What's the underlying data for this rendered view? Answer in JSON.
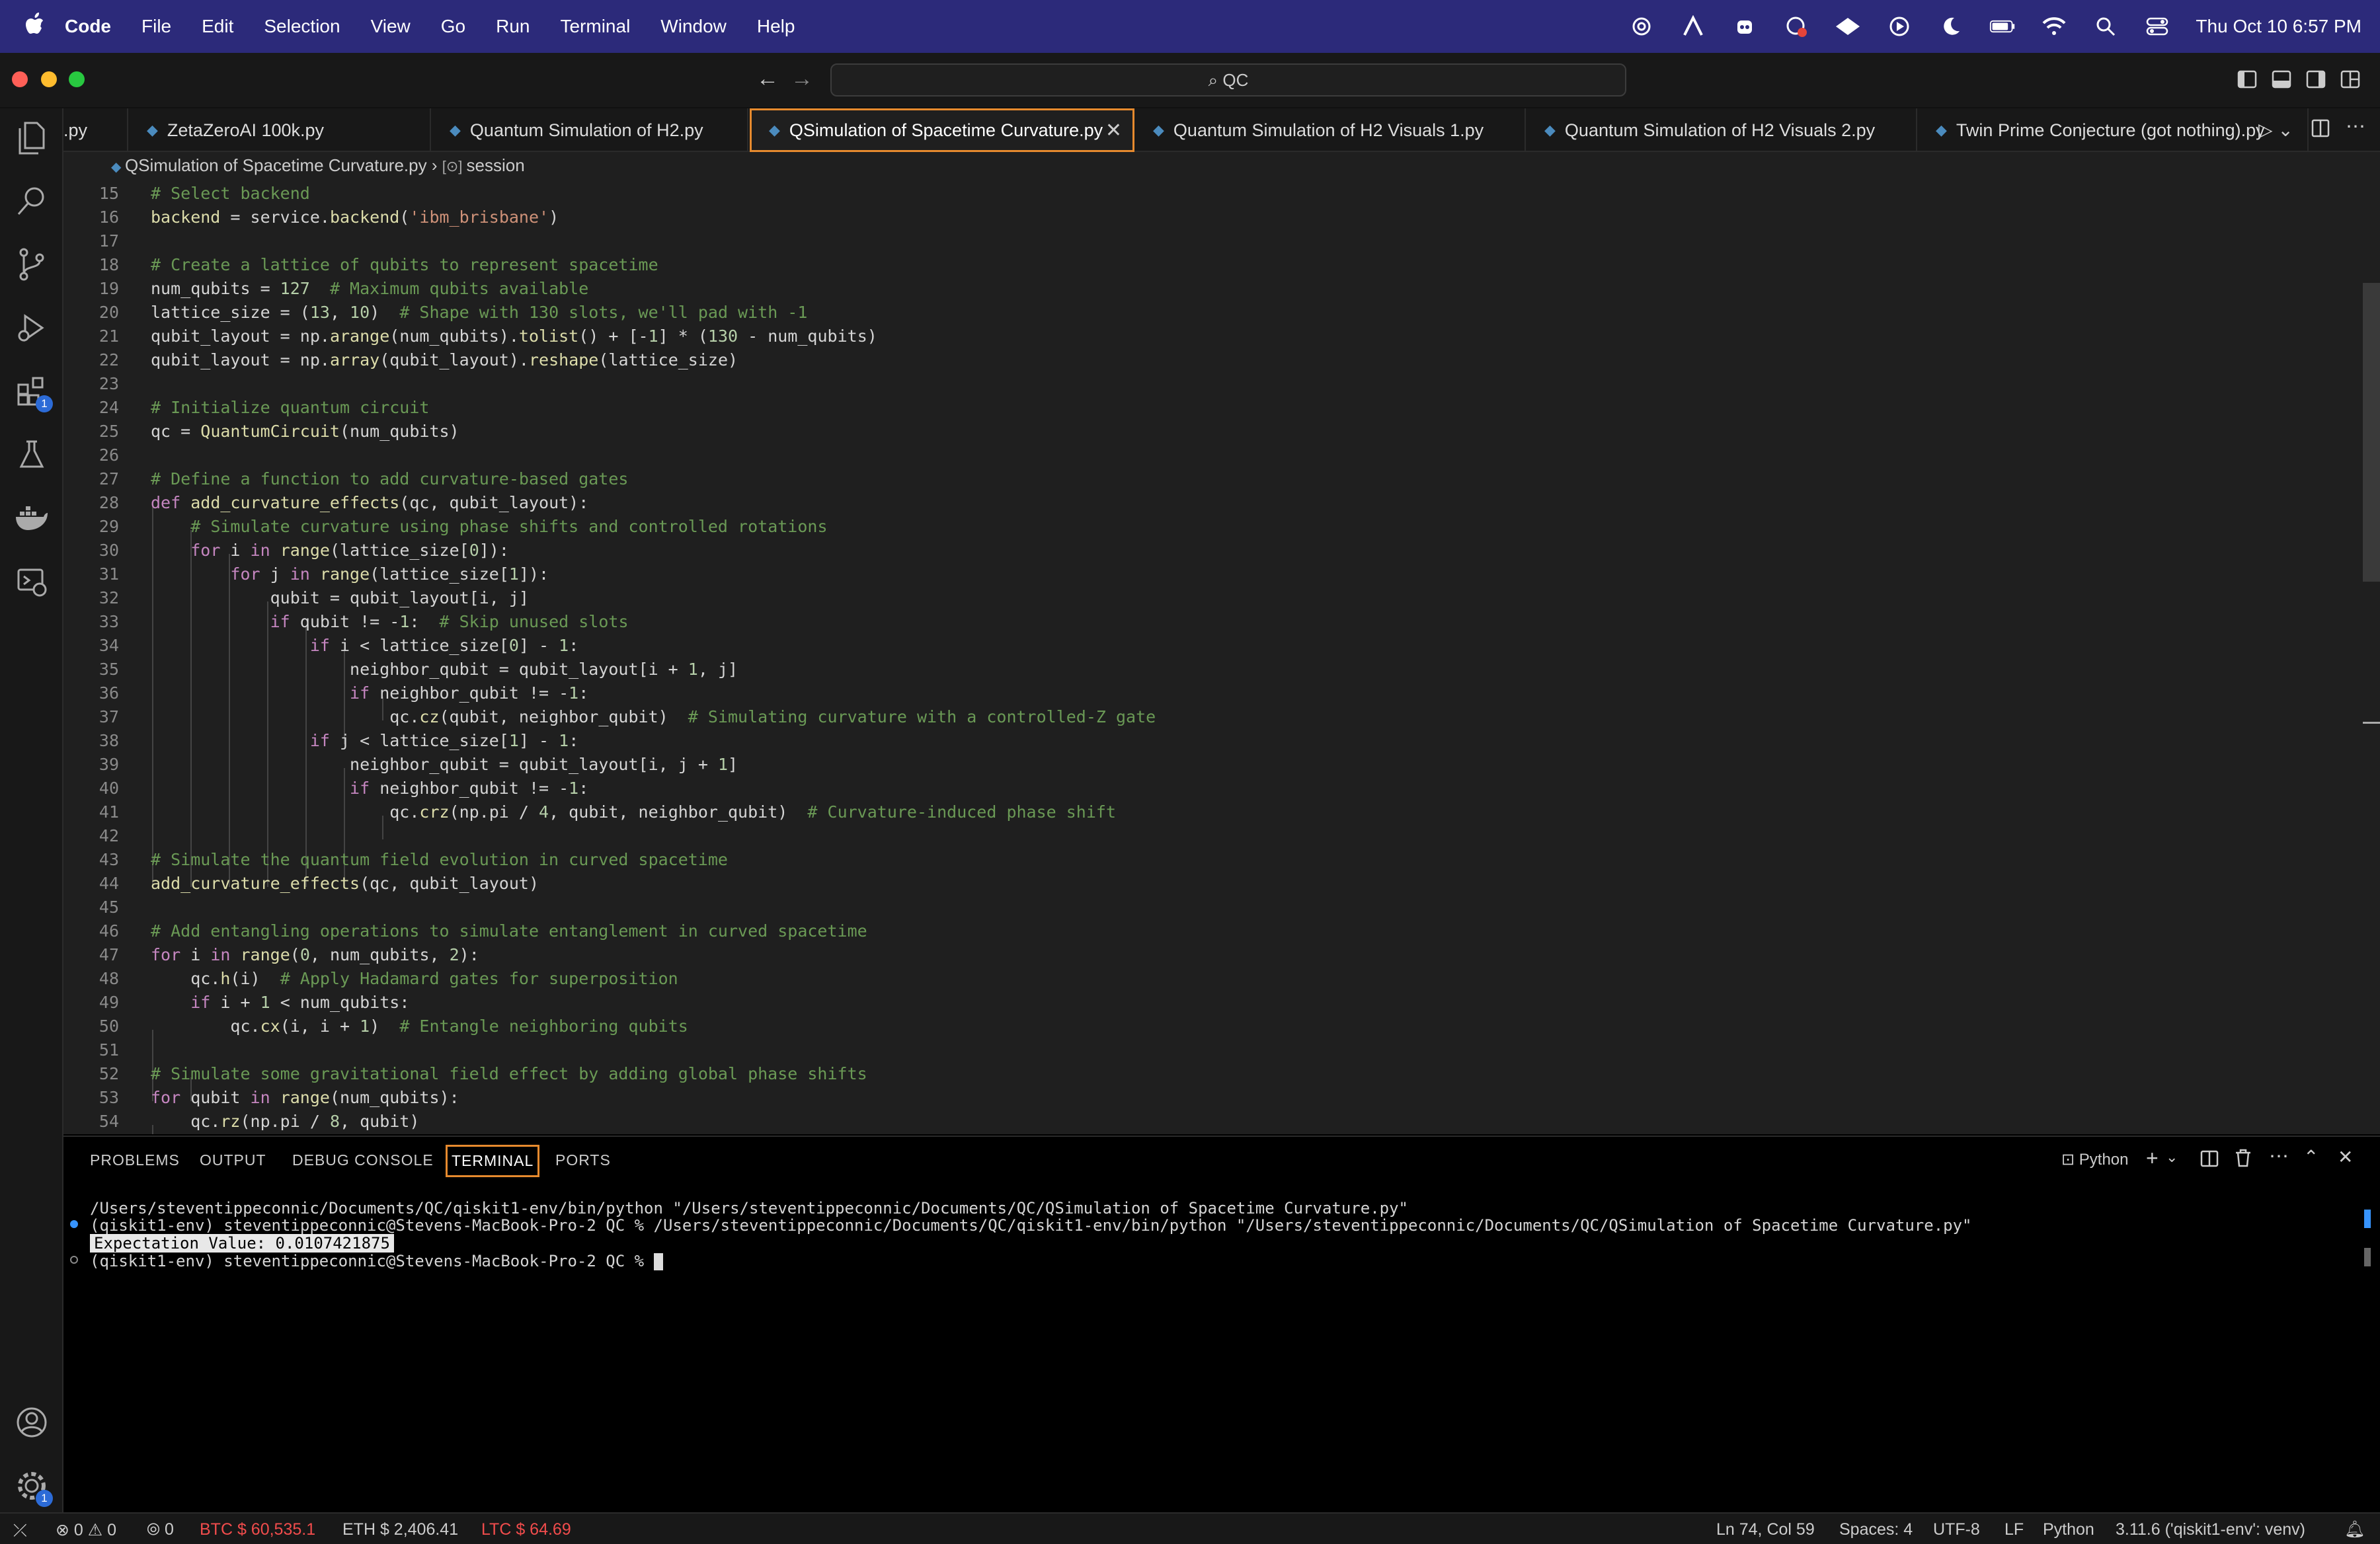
{
  "menubar": {
    "app": "Code",
    "items": [
      "File",
      "Edit",
      "Selection",
      "View",
      "Go",
      "Run",
      "Terminal",
      "Window",
      "Help"
    ],
    "clock": "Thu Oct 10  6:57 PM"
  },
  "search": {
    "text": "QC"
  },
  "tabs": [
    {
      "label": ".py"
    },
    {
      "label": "ZetaZeroAI 100k.py"
    },
    {
      "label": "Quantum Simulation of H2.py"
    },
    {
      "label": "QSimulation of Spacetime Curvature.py",
      "active": true
    },
    {
      "label": "Quantum Simulation of H2 Visuals 1.py"
    },
    {
      "label": "Quantum Simulation of H2 Visuals 2.py"
    },
    {
      "label": "Twin Prime Conjecture (got nothing).py"
    }
  ],
  "breadcrumb": {
    "file": "QSimulation of Spacetime Curvature.py",
    "symbol": "session"
  },
  "editor": {
    "lines": [
      {
        "n": "15",
        "text": "# Select backend"
      },
      {
        "n": "16",
        "text": "backend = service.backend('ibm_brisbane')"
      },
      {
        "n": "17",
        "text": ""
      },
      {
        "n": "18",
        "text": "# Create a lattice of qubits to represent spacetime"
      },
      {
        "n": "19",
        "text": "num_qubits = 127  # Maximum qubits available"
      },
      {
        "n": "20",
        "text": "lattice_size = (13, 10)  # Shape with 130 slots, we'll pad with -1"
      },
      {
        "n": "21",
        "text": "qubit_layout = np.arange(num_qubits).tolist() + [-1] * (130 - num_qubits)"
      },
      {
        "n": "22",
        "text": "qubit_layout = np.array(qubit_layout).reshape(lattice_size)"
      },
      {
        "n": "23",
        "text": ""
      },
      {
        "n": "24",
        "text": "# Initialize quantum circuit"
      },
      {
        "n": "25",
        "text": "qc = QuantumCircuit(num_qubits)"
      },
      {
        "n": "26",
        "text": ""
      },
      {
        "n": "27",
        "text": "# Define a function to add curvature-based gates"
      },
      {
        "n": "28",
        "text": "def add_curvature_effects(qc, qubit_layout):"
      },
      {
        "n": "29",
        "text": "    # Simulate curvature using phase shifts and controlled rotations"
      },
      {
        "n": "30",
        "text": "    for i in range(lattice_size[0]):"
      },
      {
        "n": "31",
        "text": "        for j in range(lattice_size[1]):"
      },
      {
        "n": "32",
        "text": "            qubit = qubit_layout[i, j]"
      },
      {
        "n": "33",
        "text": "            if qubit != -1:  # Skip unused slots"
      },
      {
        "n": "34",
        "text": "                if i < lattice_size[0] - 1:"
      },
      {
        "n": "35",
        "text": "                    neighbor_qubit = qubit_layout[i + 1, j]"
      },
      {
        "n": "36",
        "text": "                    if neighbor_qubit != -1:"
      },
      {
        "n": "37",
        "text": "                        qc.cz(qubit, neighbor_qubit)  # Simulating curvature with a controlled-Z gate"
      },
      {
        "n": "38",
        "text": "                if j < lattice_size[1] - 1:"
      },
      {
        "n": "39",
        "text": "                    neighbor_qubit = qubit_layout[i, j + 1]"
      },
      {
        "n": "40",
        "text": "                    if neighbor_qubit != -1:"
      },
      {
        "n": "41",
        "text": "                        qc.crz(np.pi / 4, qubit, neighbor_qubit)  # Curvature-induced phase shift"
      },
      {
        "n": "42",
        "text": ""
      },
      {
        "n": "43",
        "text": "# Simulate the quantum field evolution in curved spacetime"
      },
      {
        "n": "44",
        "text": "add_curvature_effects(qc, qubit_layout)"
      },
      {
        "n": "45",
        "text": ""
      },
      {
        "n": "46",
        "text": "# Add entangling operations to simulate entanglement in curved spacetime"
      },
      {
        "n": "47",
        "text": "for i in range(0, num_qubits, 2):"
      },
      {
        "n": "48",
        "text": "    qc.h(i)  # Apply Hadamard gates for superposition"
      },
      {
        "n": "49",
        "text": "    if i + 1 < num_qubits:"
      },
      {
        "n": "50",
        "text": "        qc.cx(i, i + 1)  # Entangle neighboring qubits"
      },
      {
        "n": "51",
        "text": ""
      },
      {
        "n": "52",
        "text": "# Simulate some gravitational field effect by adding global phase shifts"
      },
      {
        "n": "53",
        "text": "for qubit in range(num_qubits):"
      },
      {
        "n": "54",
        "text": "    qc.rz(np.pi / 8, qubit)"
      }
    ]
  },
  "panel": {
    "tabs": [
      "PROBLEMS",
      "OUTPUT",
      "DEBUG CONSOLE",
      "TERMINAL",
      "PORTS"
    ],
    "active": "TERMINAL",
    "shell": "Python"
  },
  "terminal": {
    "lines": [
      "/Users/steventippeconnic/Documents/QC/qiskit1-env/bin/python \"/Users/steventippeconnic/Documents/QC/QSimulation of Spacetime Curvature.py\"",
      "(qiskit1-env) steventippeconnic@Stevens-MacBook-Pro-2 QC % /Users/steventippeconnic/Documents/QC/qiskit1-env/bin/python \"/Users/steventippeconnic/Documents/QC/QSimulation of Spacetime Curvature.py\"",
      "Expectation Value: 0.0107421875",
      "(qiskit1-env) steventippeconnic@Stevens-MacBook-Pro-2 QC % "
    ]
  },
  "status": {
    "errors": "0",
    "warnings": "0",
    "ports": "0",
    "btc": "BTC $ 60,535.1",
    "eth": "ETH $ 2,406.41",
    "ltc": "LTC $ 64.69",
    "position": "Ln 74, Col 59",
    "spaces": "Spaces: 4",
    "encoding": "UTF-8",
    "eol": "LF",
    "language": "Python",
    "interpreter": "3.11.6 ('qiskit1-env': venv)"
  },
  "colors": {
    "menubar": "#2c2a7a",
    "accent": "#e68a2e",
    "keyword": "#c586c0",
    "comment": "#6a9955",
    "string": "#ce9178",
    "number": "#b5cea8",
    "function": "#dcdcaa"
  }
}
